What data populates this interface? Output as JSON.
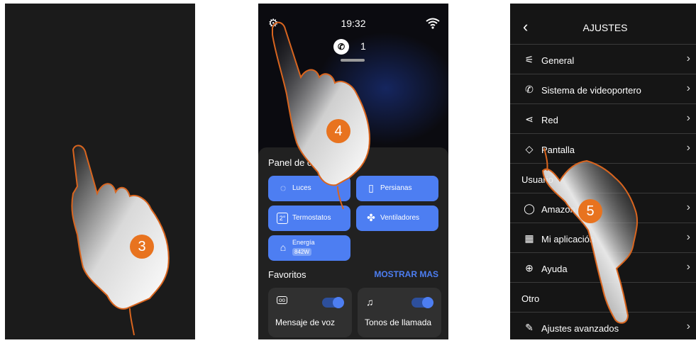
{
  "steps": {
    "s1": "3",
    "s2": "4",
    "s3": "5"
  },
  "home": {
    "time": "19:32",
    "missed_count": "1",
    "panel_title": "Panel de control",
    "buttons": [
      {
        "label": "Luces",
        "icon": "bulb-icon"
      },
      {
        "label": "Persianas",
        "icon": "shutter-icon"
      },
      {
        "label": "Termostatos",
        "icon": "thermostat-icon"
      },
      {
        "label": "Ventiladores",
        "icon": "fan-icon"
      }
    ],
    "energy": {
      "label": "Energía",
      "value": "842W"
    },
    "favorites_title": "Favoritos",
    "show_more": "MOSTRAR MAS",
    "cards": [
      {
        "label": "Mensaje de voz",
        "icon": "voicemail-icon"
      },
      {
        "label": "Tonos de llamada",
        "icon": "bell-icon"
      }
    ]
  },
  "settings": {
    "title": "AJUSTES",
    "items": [
      {
        "label": "General",
        "icon": "sliders-icon"
      },
      {
        "label": "Sistema de videoportero",
        "icon": "phone-icon"
      },
      {
        "label": "Red",
        "icon": "share-icon"
      },
      {
        "label": "Pantalla",
        "icon": "display-icon"
      }
    ],
    "section_user": "Usuario",
    "user_items": [
      {
        "label": "Amazon",
        "icon": "alexa-icon"
      },
      {
        "label": "Mi aplicación",
        "icon": "qr-icon"
      },
      {
        "label": "Ayuda",
        "icon": "help-icon"
      }
    ],
    "section_other": "Otro",
    "other_items": [
      {
        "label": "Ajustes avanzados",
        "icon": "wrench-icon"
      }
    ]
  },
  "colors": {
    "accent": "#4d7ef2",
    "step": "#e8731f"
  }
}
